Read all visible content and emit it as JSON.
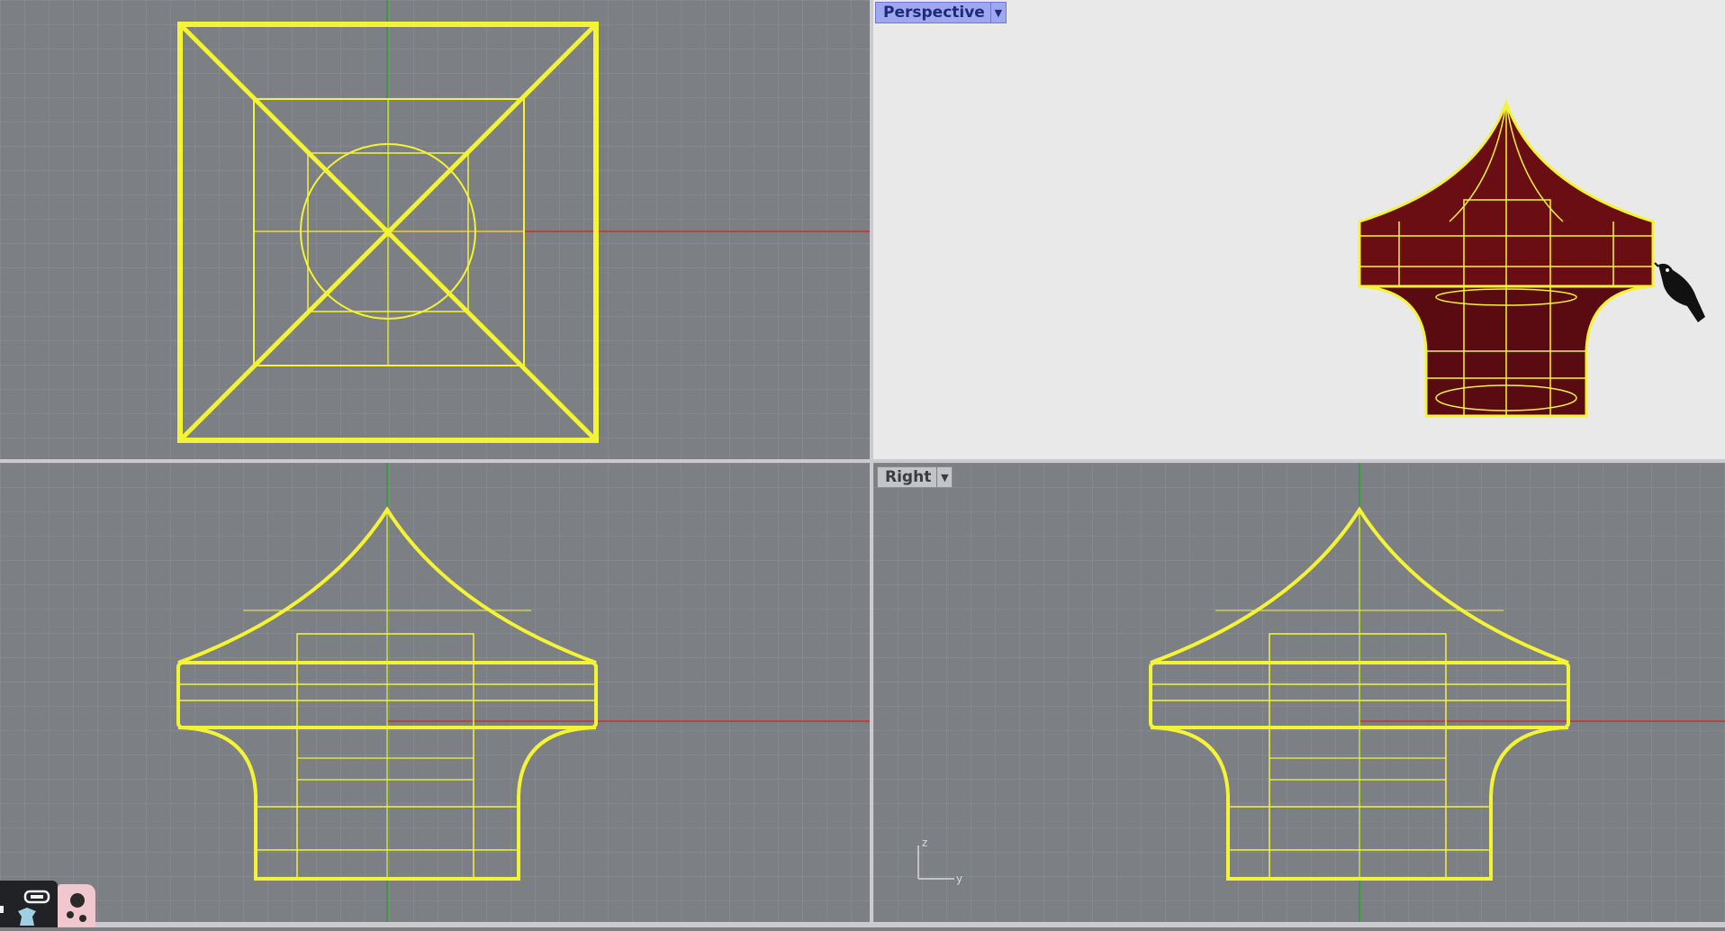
{
  "viewports": {
    "top": {
      "label": ""
    },
    "perspective": {
      "label": "Perspective"
    },
    "front": {
      "label": ""
    },
    "right": {
      "label": "Right"
    }
  },
  "axis_widget": {
    "z_label": "z",
    "y_label": "y"
  },
  "colors": {
    "viewport_bg": "#7c7f84",
    "grid": "#8e9196",
    "perspective_bg": "#e9e9ea",
    "wire_selected": "#f4f436",
    "x_axis": "#c9302f",
    "y_axis": "#2f9b35",
    "surface_dark_red": "#6b0e14"
  },
  "icons": {
    "viewport_dropdown": "chevron-down-icon",
    "bird": "bird-icon",
    "toolbar": [
      "gamepad-icon",
      "pointer-icon"
    ]
  }
}
